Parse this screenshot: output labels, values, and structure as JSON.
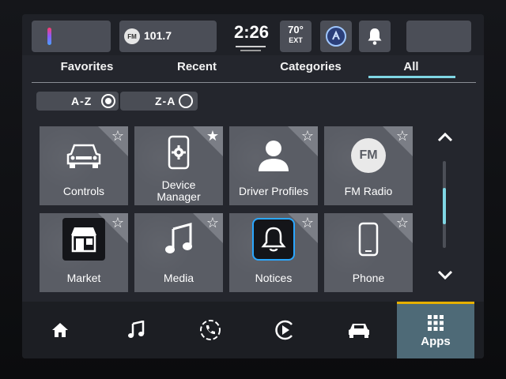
{
  "status_bar": {
    "radio_badge": "FM",
    "radio_frequency": "101.7",
    "clock": "2:26",
    "temperature": "70°",
    "temperature_label": "EXT"
  },
  "tabs": [
    {
      "label": "Favorites",
      "active": false
    },
    {
      "label": "Recent",
      "active": false
    },
    {
      "label": "Categories",
      "active": false
    },
    {
      "label": "All",
      "active": true
    }
  ],
  "sort": {
    "az_label": "A-Z",
    "za_label": "Z-A",
    "selected": "A-Z"
  },
  "apps": [
    {
      "name": "Controls",
      "icon": "car-front-icon",
      "favorite": false
    },
    {
      "name": "Device Manager",
      "icon": "phone-gear-icon",
      "favorite": true
    },
    {
      "name": "Driver Profiles",
      "icon": "person-icon",
      "favorite": false
    },
    {
      "name": "FM Radio",
      "icon": "fm-radio-icon",
      "icon_text": "FM",
      "favorite": false
    },
    {
      "name": "Market",
      "icon": "market-store-icon",
      "favorite": false
    },
    {
      "name": "Media",
      "icon": "music-note-icon",
      "favorite": false
    },
    {
      "name": "Notices",
      "icon": "bell-icon",
      "favorite": false
    },
    {
      "name": "Phone",
      "icon": "smartphone-icon",
      "favorite": false
    }
  ],
  "bottom_nav": {
    "items": [
      "home-icon",
      "music-note-icon",
      "phone-icon",
      "navigation-icon",
      "vehicle-icon",
      "apps-grid-icon"
    ],
    "apps_label": "Apps",
    "active": "Apps"
  },
  "colors": {
    "accent": "#7fd6e4",
    "apps_highlight": "#e6b000",
    "tile": "#5a5d65"
  }
}
